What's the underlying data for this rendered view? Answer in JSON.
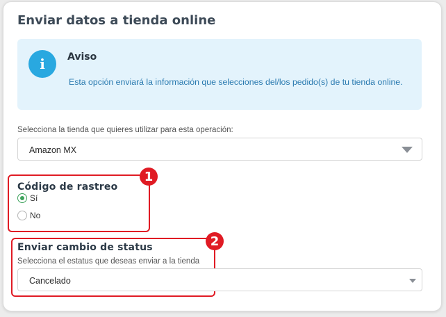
{
  "page": {
    "title": "Enviar datos a tienda online"
  },
  "alert": {
    "icon": "info-icon",
    "icon_glyph": "i",
    "title": "Aviso",
    "text": "Esta opción enviará la información que selecciones del/los pedido(s) de tu tienda online."
  },
  "store": {
    "label": "Selecciona la tienda que quieres utilizar para esta operación:",
    "selected": "Amazon MX"
  },
  "tracking": {
    "badge": "1",
    "title": "Código de rastreo",
    "options": [
      {
        "label": "Sí",
        "checked": true
      },
      {
        "label": "No",
        "checked": false
      }
    ]
  },
  "status": {
    "badge": "2",
    "title": "Enviar cambio de status",
    "help": "Selecciona el estatus que deseas enviar a la tienda",
    "selected": "Cancelado"
  },
  "colors": {
    "accent_info": "#29a8e0",
    "alert_bg": "#e3f3fc",
    "highlight": "#e01b24",
    "radio_checked": "#3ea35c"
  }
}
